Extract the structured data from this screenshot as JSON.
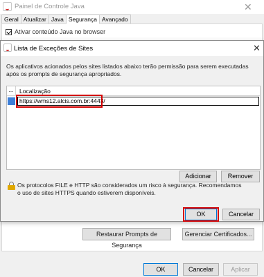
{
  "background_window": {
    "title": "Painel de Controle Java",
    "close_glyph": "✕",
    "tabs": [
      "Geral",
      "Atualizar",
      "Java",
      "Segurança",
      "Avançado"
    ],
    "active_tab": "Segurança",
    "enable_java_label": "Ativar conteúdo Java no browser",
    "enable_java_checked": true,
    "restore_prompts_label": "Restaurar Prompts de Segurança",
    "manage_certs_label": "Gerenciar Certificados...",
    "footer": {
      "ok_label": "OK",
      "cancel_label": "Cancelar",
      "apply_label": "Aplicar"
    }
  },
  "dialog": {
    "title": "Lista de Exceções de Sites",
    "close_glyph": "✕",
    "description": "Os aplicativos acionados pelos sites listados abaixo terão permissão para serem executadas após os prompts de segurança apropriados.",
    "list": {
      "col_dots": "...",
      "col_location": "Localização",
      "rows": [
        {
          "location": "https://wms12.alcis.com.br:4443/"
        }
      ]
    },
    "add_label": "Adicionar",
    "remove_label": "Remover",
    "warning_text": "Os protocolos FILE e HTTP são considerados um risco à segurança. Recomendamos o uso de sites HTTPS quando estiverem disponíveis.",
    "ok_label": "OK",
    "cancel_label": "Cancelar"
  },
  "colors": {
    "highlight": "#d50000",
    "selection_marker": "#3d7fd8",
    "focus_border": "#0078d7"
  },
  "icons": {
    "app": "java-icon",
    "warning": "lock-warning-icon"
  }
}
